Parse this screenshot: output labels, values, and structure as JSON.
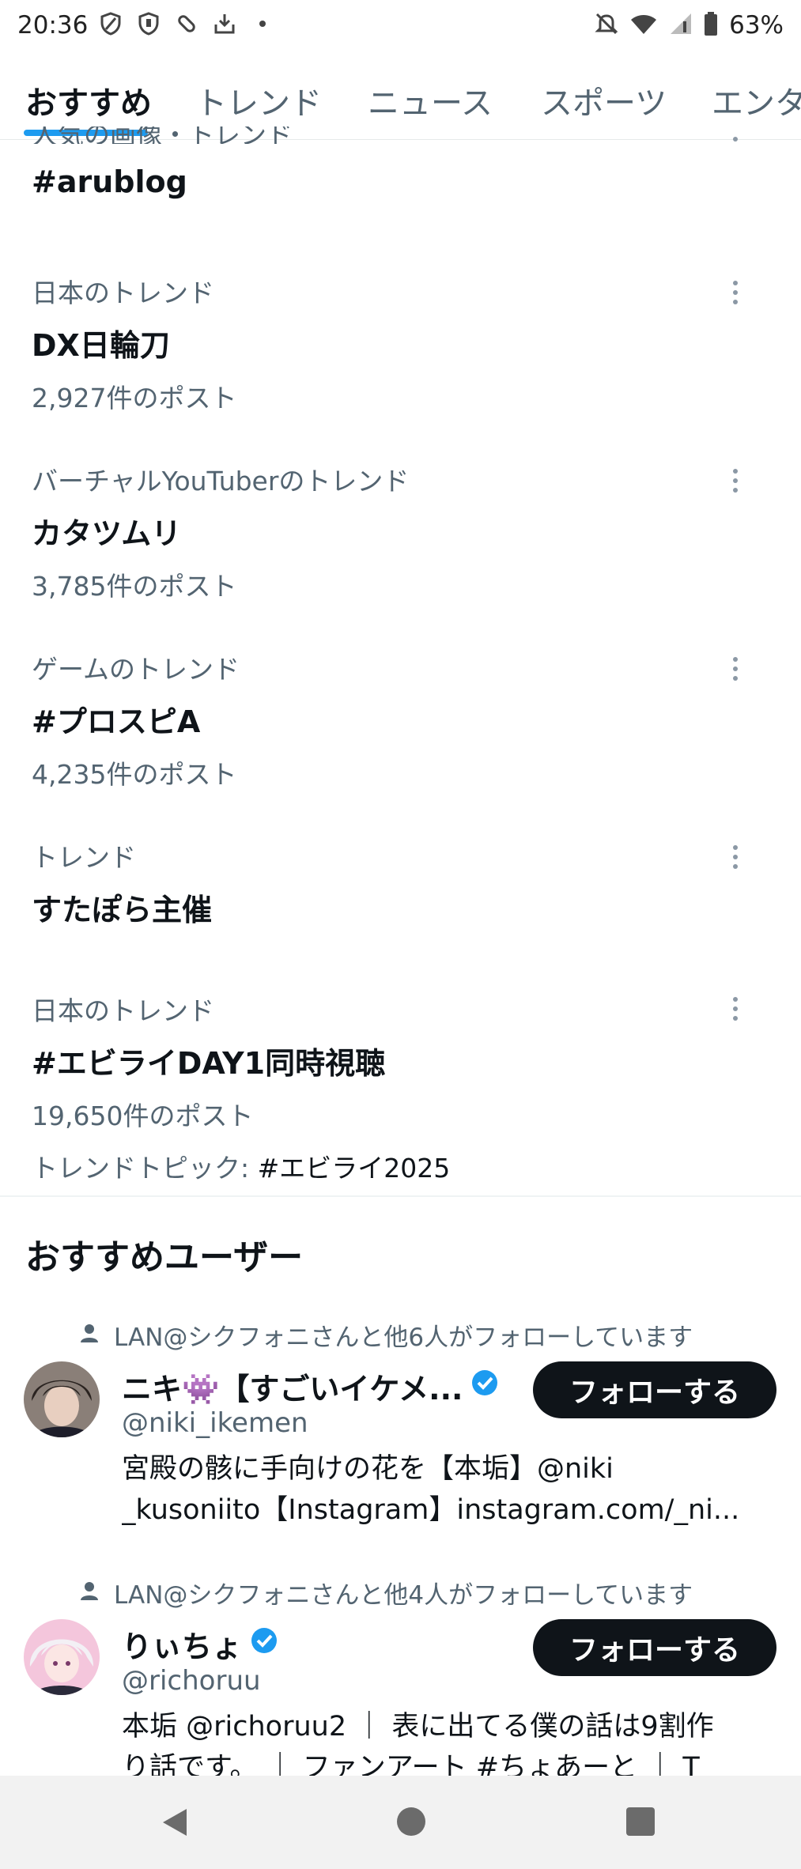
{
  "status_bar": {
    "time": "20:36",
    "battery": "63%",
    "icons_left": [
      "shield-outline-icon",
      "shield-icon",
      "pill-icon",
      "download-tray-icon",
      "dot-icon"
    ],
    "icons_right": [
      "bell-off-icon",
      "wifi-icon",
      "signal-icon",
      "battery-icon"
    ]
  },
  "tabs": [
    {
      "label": "おすすめ",
      "active": true
    },
    {
      "label": "トレンド",
      "active": false
    },
    {
      "label": "ニュース",
      "active": false
    },
    {
      "label": "スポーツ",
      "active": false
    },
    {
      "label": "エンタ",
      "active": false
    }
  ],
  "trends": [
    {
      "category": "人気の画像・トレンド",
      "name": "#arublog"
    },
    {
      "category": "日本のトレンド",
      "name": "DX日輪刀",
      "count": "2,927件のポスト"
    },
    {
      "category": "バーチャルYouTuberのトレンド",
      "name": "カタツムリ",
      "count": "3,785件のポスト"
    },
    {
      "category": "ゲームのトレンド",
      "name": "#プロスピA",
      "count": "4,235件のポスト"
    },
    {
      "category": "トレンド",
      "name": "すたぽら主催"
    },
    {
      "category": "日本のトレンド",
      "name": "#エビライDAY1同時視聴",
      "count": "19,650件のポスト",
      "topic_prefix": "トレンドトピック: ",
      "topic": "#エビライ2025"
    }
  ],
  "recommended": {
    "title": "おすすめユーザー",
    "users": [
      {
        "social_context": "LAN@シクフォニさんと他6人がフォローしています",
        "name": "ニキ👾【すごいイケメ...",
        "verified": true,
        "handle": "@niki_ikemen",
        "bio_line1": "宮殿の骸に手向けの花を【本垢】@niki",
        "bio_line2": "_kusoniito【Instagram】instagram.com/_ni...",
        "follow_label": "フォローする"
      },
      {
        "social_context": "LAN@シクフォニさんと他4人がフォローしています",
        "name": "りぃちょ",
        "verified": true,
        "handle": "@richoruu",
        "bio_line1": "本垢 @richoruu2 ｜ 表に出てる僕の話は9割作",
        "bio_line2": "り話です。 ｜ ファンアート #ちょあーと ｜ T",
        "follow_label": "フォローする"
      }
    ]
  },
  "colors": {
    "accent": "#1d9bf0",
    "text_primary": "#0f1419",
    "text_secondary": "#536471",
    "button_bg": "#0f1419"
  }
}
